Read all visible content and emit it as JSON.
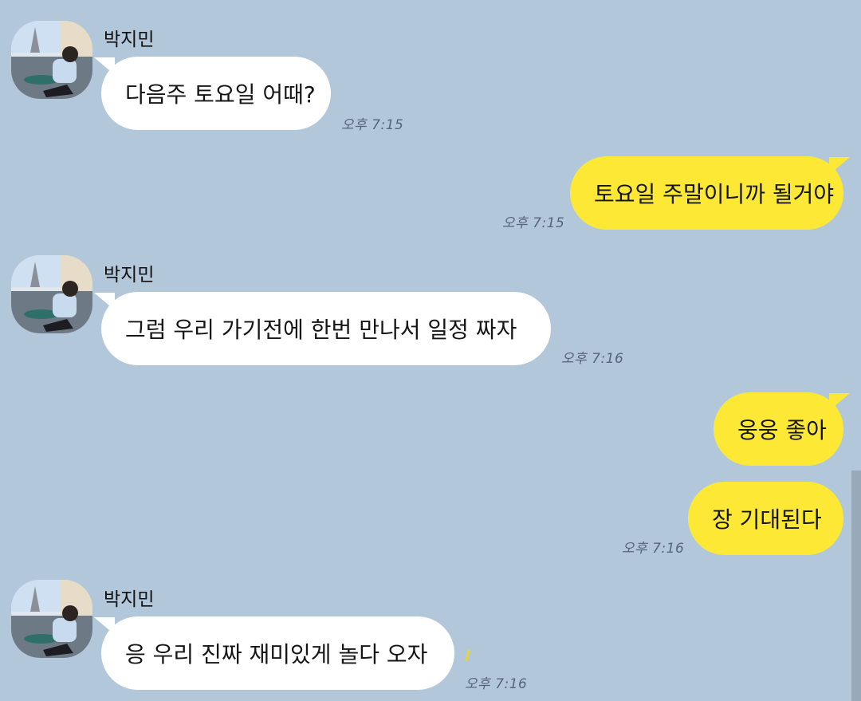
{
  "colors": {
    "background": "#b2c7da",
    "incoming_bubble": "#ffffff",
    "outgoing_bubble": "#fde935"
  },
  "avatar_icon": "profile-photo-icon",
  "messages": [
    {
      "sender": "박지민",
      "text": "다음주 토요일 어때?",
      "time": "오후 7:15"
    },
    {
      "text": "토요일 주말이니까 될거야",
      "time": "오후 7:15"
    },
    {
      "sender": "박지민",
      "text": "그럼 우리 가기전에 한번 만나서 일정 짜자",
      "time": "오후 7:16"
    },
    {
      "text": "웅웅 좋아"
    },
    {
      "text": "장 기대된다",
      "time": "오후 7:16"
    },
    {
      "sender": "박지민",
      "text": "응 우리 진짜 재미있게 놀다 오자",
      "time": "오후 7:16"
    }
  ]
}
